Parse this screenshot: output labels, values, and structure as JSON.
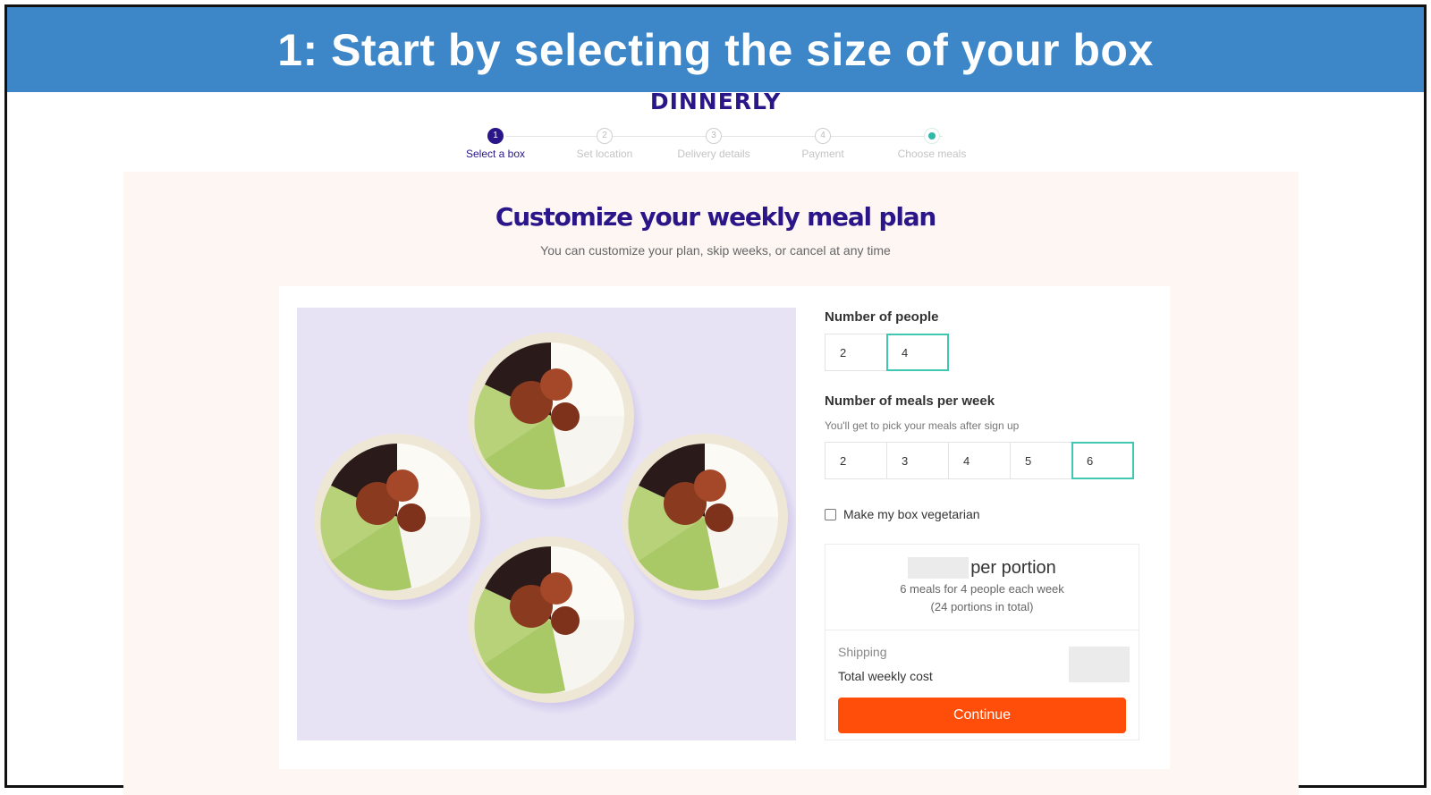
{
  "banner": {
    "title": "1: Start by selecting the size of your box"
  },
  "brand": {
    "logo_text": "DINNERLY",
    "color": "#2a1688",
    "accent": "#3fc7b1",
    "cta_color": "#ff4d0a"
  },
  "stepper": {
    "steps": [
      {
        "number": "1",
        "label": "Select a box",
        "state": "active"
      },
      {
        "number": "2",
        "label": "Set location",
        "state": "inactive"
      },
      {
        "number": "3",
        "label": "Delivery details",
        "state": "inactive"
      },
      {
        "number": "4",
        "label": "Payment",
        "state": "inactive"
      },
      {
        "number": "",
        "label": "Choose meals",
        "state": "inactive"
      }
    ]
  },
  "main": {
    "title": "Customize your weekly meal plan",
    "subtitle": "You can customize your plan, skip weeks, or cancel at any time",
    "image_icon": "meal-bowls-photo"
  },
  "people": {
    "label": "Number of people",
    "options": [
      "2",
      "4"
    ],
    "selected": "4"
  },
  "meals": {
    "label": "Number of meals per week",
    "hint": "You'll get to pick your meals after sign up",
    "options": [
      "2",
      "3",
      "4",
      "5",
      "6"
    ],
    "selected": "6"
  },
  "vegetarian": {
    "label": "Make my box vegetarian",
    "checked": false
  },
  "pricing": {
    "per_portion_label": "per portion",
    "line1": "6 meals for 4 people each week",
    "line2": "(24 portions in total)",
    "shipping_label": "Shipping",
    "total_label": "Total weekly cost",
    "continue_label": "Continue"
  }
}
